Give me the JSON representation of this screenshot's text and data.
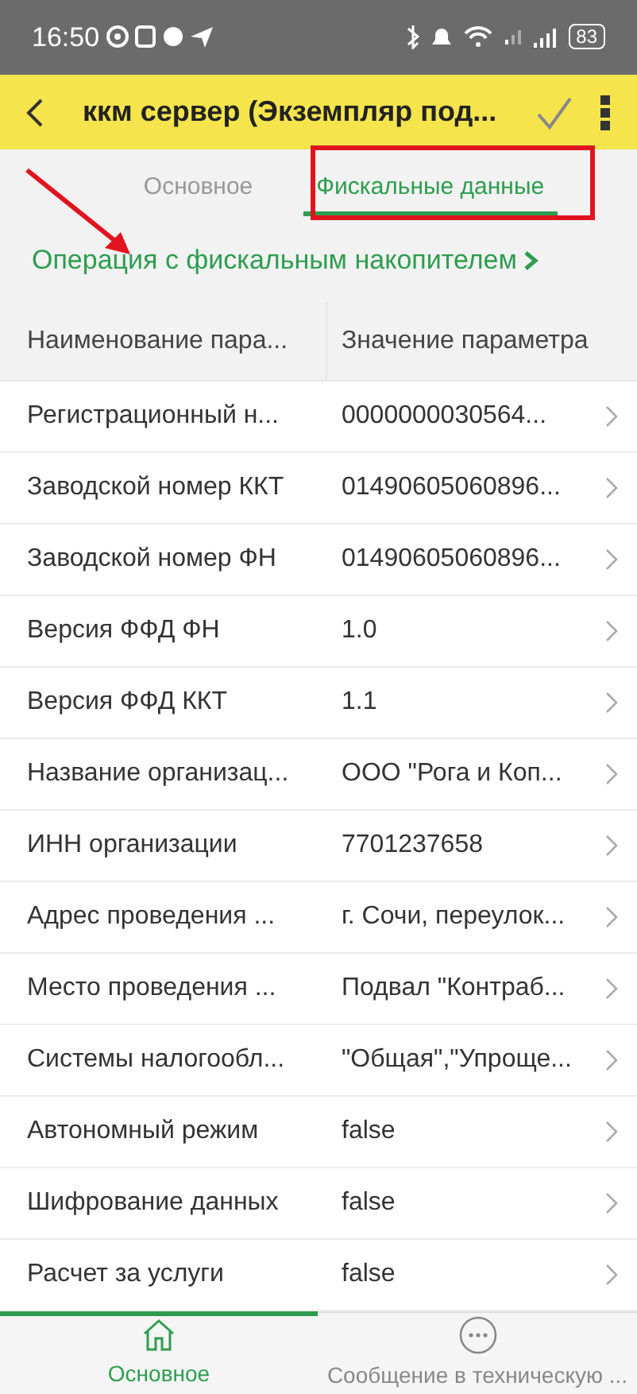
{
  "status_bar": {
    "time": "16:50",
    "battery": "83"
  },
  "header": {
    "title": "ккм сервер (Экземпляр под..."
  },
  "tabs": [
    {
      "label": "Основное",
      "selected": false
    },
    {
      "label": "Фискальные данные",
      "selected": true
    }
  ],
  "link": {
    "label": "Операция с фискальным накопителем"
  },
  "table": {
    "columns": [
      "Наименование пара...",
      "Значение параметра"
    ],
    "rows": [
      [
        "Регистрационный н...",
        "0000000030564..."
      ],
      [
        "Заводской номер ККТ",
        "01490605060896..."
      ],
      [
        "Заводской номер ФН",
        "01490605060896..."
      ],
      [
        "Версия ФФД ФН",
        "1.0"
      ],
      [
        "Версия ФФД ККТ",
        "1.1"
      ],
      [
        "Название организац...",
        "ООО \"Рога и Коп..."
      ],
      [
        "ИНН организации",
        "7701237658"
      ],
      [
        "Адрес проведения ...",
        "г. Сочи, переулок..."
      ],
      [
        "Место проведения ...",
        "Подвал \"Контраб..."
      ],
      [
        "Системы налогообл...",
        "\"Общая\",\"Упроще..."
      ],
      [
        "Автономный режим",
        "false"
      ],
      [
        "Шифрование данных",
        "false"
      ],
      [
        "Расчет за услуги",
        "false"
      ]
    ]
  },
  "bottom_nav": [
    {
      "label": "Основное",
      "selected": true,
      "kind": "home"
    },
    {
      "label": "Сообщение в техническую ...",
      "selected": false,
      "kind": "more"
    }
  ]
}
